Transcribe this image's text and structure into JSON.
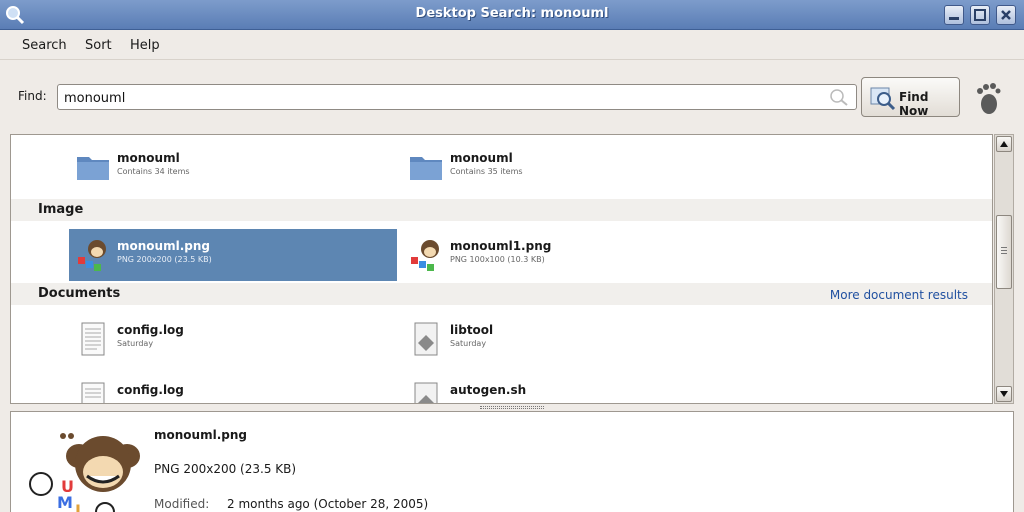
{
  "window": {
    "title": "Desktop Search: monouml"
  },
  "menu": {
    "items": [
      {
        "label": "Search"
      },
      {
        "label": "Sort"
      },
      {
        "label": "Help"
      }
    ]
  },
  "find": {
    "label": "Find:",
    "value": "monouml",
    "button_label": "Find Now"
  },
  "results": {
    "folders": [
      {
        "name": "monouml",
        "desc": "Contains 34 items"
      },
      {
        "name": "monouml",
        "desc": "Contains 35 items"
      }
    ],
    "image_section": {
      "title": "Image"
    },
    "images": [
      {
        "name": "monouml.png",
        "desc": "PNG 200x200 (23.5 KB)",
        "selected": true
      },
      {
        "name": "monouml1.png",
        "desc": "PNG 100x100 (10.3 KB)",
        "selected": false
      }
    ],
    "documents_section": {
      "title": "Documents",
      "more_link": "More document results"
    },
    "documents": [
      {
        "name": "config.log",
        "desc": "Saturday",
        "icon": "text-file-icon"
      },
      {
        "name": "libtool",
        "desc": "Saturday",
        "icon": "script-file-icon"
      },
      {
        "name": "config.log",
        "desc": "",
        "icon": "text-file-icon"
      },
      {
        "name": "autogen.sh",
        "desc": "",
        "icon": "script-file-icon"
      }
    ]
  },
  "preview": {
    "name": "monouml.png",
    "desc": "PNG 200x200 (23.5 KB)",
    "modified_label": "Modified:",
    "modified_value": "2 months ago (October 28, 2005)"
  },
  "colors": {
    "titlebar": "#5a7db5",
    "selection": "#5d86b2",
    "folder": "#6f98cc",
    "link": "#2050a0"
  }
}
